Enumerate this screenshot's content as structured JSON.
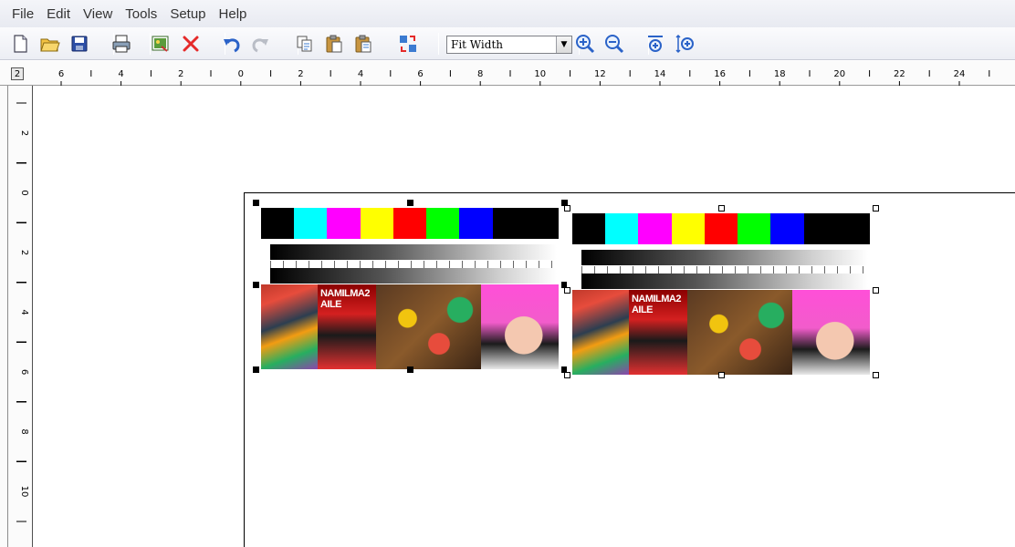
{
  "menu": [
    "File",
    "Edit",
    "View",
    "Tools",
    "Setup",
    "Help"
  ],
  "toolbar": {
    "buttons": [
      {
        "name": "new-icon",
        "label": "New"
      },
      {
        "name": "open-icon",
        "label": "Open"
      },
      {
        "name": "save-icon",
        "label": "Save"
      },
      {
        "name": "print-icon",
        "label": "Print"
      },
      {
        "name": "import-image-icon",
        "label": "Import Image"
      },
      {
        "name": "delete-icon",
        "label": "Delete"
      },
      {
        "name": "undo-icon",
        "label": "Undo"
      },
      {
        "name": "redo-icon",
        "label": "Redo"
      },
      {
        "name": "copy-icon",
        "label": "Copy"
      },
      {
        "name": "paste-icon",
        "label": "Paste"
      },
      {
        "name": "paste-special-icon",
        "label": "Paste Special"
      },
      {
        "name": "rotate-icon",
        "label": "Rotate"
      },
      {
        "name": "zoom-in-icon",
        "label": "Zoom In"
      },
      {
        "name": "zoom-out-icon",
        "label": "Zoom Out"
      },
      {
        "name": "fit-page-icon",
        "label": "Fit Page"
      },
      {
        "name": "fit-height-icon",
        "label": "Fit Height"
      }
    ],
    "zoom": "Fit Width"
  },
  "ruler": {
    "corner": "2",
    "h_labels": [
      "6",
      "4",
      "2",
      "0",
      "2",
      "4",
      "6",
      "8",
      "10",
      "12",
      "14",
      "16",
      "18",
      "20",
      "22",
      "24",
      "2"
    ],
    "v_labels": [
      "2",
      "0",
      "2",
      "4",
      "6",
      "8",
      "10"
    ]
  },
  "sheet": {
    "swatch_colors": [
      "#000000",
      "#00ffff",
      "#ff00ff",
      "#ffff00",
      "#ff0000",
      "#00ff00",
      "#0000ff",
      "#000000",
      "#000000"
    ],
    "photo_caption": "NAMILMA2 AILE"
  },
  "colors": {
    "menubar": "#eceef4",
    "selection_handle": "#000000"
  }
}
